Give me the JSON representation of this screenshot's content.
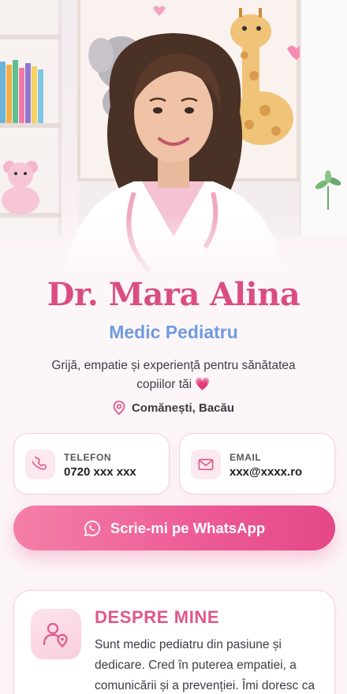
{
  "profile": {
    "name": "Dr. Mara Alina",
    "role": "Medic Pediatru",
    "tagline": "Grijă, empatie și experiență pentru sănătatea copiilor tăi",
    "tagline_emoji": "💗",
    "location": "Comănești, Bacău"
  },
  "contacts": {
    "phone": {
      "label": "TELEFON",
      "value": "0720 xxx xxx",
      "icon": "phone-icon"
    },
    "email": {
      "label": "EMAIL",
      "value": "xxx@xxxx.ro",
      "icon": "mail-icon"
    }
  },
  "whatsapp": {
    "label": "Scrie-mi pe WhatsApp",
    "icon": "whatsapp-icon"
  },
  "about": {
    "title": "DESPRE MINE",
    "text": "Sunt medic pediatru din pasiune și dedicare. Cred în puterea empatiei, a comunicării și a prevenției. Îmi doresc ca",
    "icon": "user-location-icon"
  },
  "colors": {
    "accent_pink": "#d94d83",
    "accent_blue": "#6f9be0",
    "button_gradient_start": "#f47fa8",
    "button_gradient_end": "#e44787",
    "background": "#fdf6f8"
  }
}
